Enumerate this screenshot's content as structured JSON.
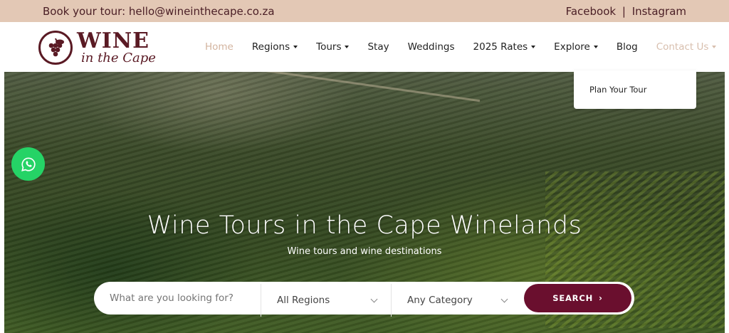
{
  "topbar": {
    "book_text": "Book your tour: hello@wineinthecape.co.za",
    "facebook": "Facebook",
    "separator": "|",
    "instagram": "Instagram"
  },
  "logo": {
    "word": "WINE",
    "script": "in the Cape",
    "icon": "grape-icon"
  },
  "nav": {
    "home": "Home",
    "regions": "Regions",
    "tours": "Tours",
    "stay": "Stay",
    "weddings": "Weddings",
    "rates": "2025 Rates",
    "explore": "Explore",
    "blog": "Blog",
    "contact": "Contact Us"
  },
  "dropdown": {
    "plan": "Plan Your Tour"
  },
  "hero": {
    "title": "Wine Tours in the Cape Winelands",
    "subtitle": "Wine tours and wine destinations"
  },
  "search": {
    "placeholder": "What are you looking for?",
    "regions_value": "All Regions",
    "category_value": "Any Category",
    "button_label": "SEARCH"
  },
  "colors": {
    "topbar_bg": "#e3c8b5",
    "brand": "#5a1a24",
    "button": "#6a0f2e",
    "whatsapp": "#25d366"
  }
}
